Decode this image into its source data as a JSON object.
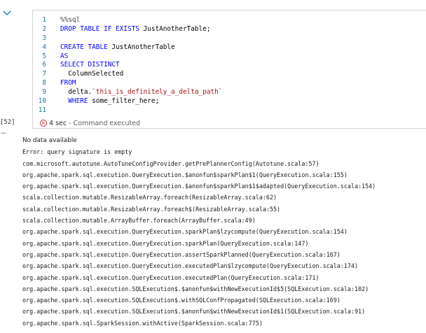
{
  "cell": {
    "execution_count": "[52]",
    "code_lines": [
      {
        "n": "1",
        "tokens": [
          {
            "t": "%%sql",
            "c": "cmt"
          }
        ]
      },
      {
        "n": "2",
        "tokens": [
          {
            "t": "DROP TABLE IF EXISTS ",
            "c": "kw"
          },
          {
            "t": "JustAnotherTable;",
            "c": "plain"
          }
        ]
      },
      {
        "n": "3",
        "tokens": []
      },
      {
        "n": "4",
        "tokens": [
          {
            "t": "CREATE TABLE ",
            "c": "kw"
          },
          {
            "t": "JustAnotherTable",
            "c": "plain"
          }
        ]
      },
      {
        "n": "5",
        "tokens": [
          {
            "t": "AS",
            "c": "kw"
          }
        ]
      },
      {
        "n": "6",
        "tokens": [
          {
            "t": "SELECT DISTINCT",
            "c": "kw"
          }
        ]
      },
      {
        "n": "7",
        "tokens": [
          {
            "t": "  ColumnSelected",
            "c": "plain"
          }
        ]
      },
      {
        "n": "8",
        "tokens": [
          {
            "t": "FROM",
            "c": "kw"
          }
        ]
      },
      {
        "n": "9",
        "tokens": [
          {
            "t": "  delta.",
            "c": "plain"
          },
          {
            "t": "`this_is_definitely_a_delta_path`",
            "c": "str"
          }
        ]
      },
      {
        "n": "10",
        "tokens": [
          {
            "t": "  WHERE ",
            "c": "kw"
          },
          {
            "t": "some_filter_here;",
            "c": "plain"
          }
        ]
      },
      {
        "n": "11",
        "tokens": []
      }
    ],
    "status": {
      "icon": "error-circle-icon",
      "duration": "4 sec",
      "separator": " - ",
      "label": "Command executed"
    }
  },
  "output": {
    "lines": [
      "No data available",
      "Error: query signature is empty",
      "com.microsoft.autotune.AutoTuneConfigProvider.getPrePlannerConfig(Autotune.scala:57)",
      "org.apache.spark.sql.execution.QueryExecution.$anonfun$sparkPlan$1(QueryExecution.scala:155)",
      "org.apache.spark.sql.execution.QueryExecution.$anonfun$sparkPlan$1$adapted(QueryExecution.scala:154)",
      "scala.collection.mutable.ResizableArray.foreach(ResizableArray.scala:62)",
      "scala.collection.mutable.ResizableArray.foreach$(ResizableArray.scala:55)",
      "scala.collection.mutable.ArrayBuffer.foreach(ArrayBuffer.scala:49)",
      "org.apache.spark.sql.execution.QueryExecution.sparkPlan$lzycompute(QueryExecution.scala:154)",
      "org.apache.spark.sql.execution.QueryExecution.sparkPlan(QueryExecution.scala:147)",
      "org.apache.spark.sql.execution.QueryExecution.assertSparkPlanned(QueryExecution.scala:167)",
      "org.apache.spark.sql.execution.QueryExecution.executedPlan$lzycompute(QueryExecution.scala:174)",
      "org.apache.spark.sql.execution.QueryExecution.executedPlan(QueryExecution.scala:171)",
      "org.apache.spark.sql.execution.SQLExecution$.$anonfun$withNewExecutionId$5(SQLExecution.scala:102)",
      "org.apache.spark.sql.execution.SQLExecution$.withSQLConfPropagated(SQLExecution.scala:169)",
      "org.apache.spark.sql.execution.SQLExecution$.$anonfun$withNewExecutionId$1(SQLExecution.scala:91)",
      "org.apache.spark.sql.SparkSession.withActive(SparkSession.scala:775)"
    ]
  },
  "colors": {
    "keyword": "#0000ff",
    "string": "#a31515",
    "line_number": "#237893",
    "error": "#d13438"
  },
  "icons": {
    "collapse": "chevron-down-icon",
    "more": "more-options-icon"
  }
}
